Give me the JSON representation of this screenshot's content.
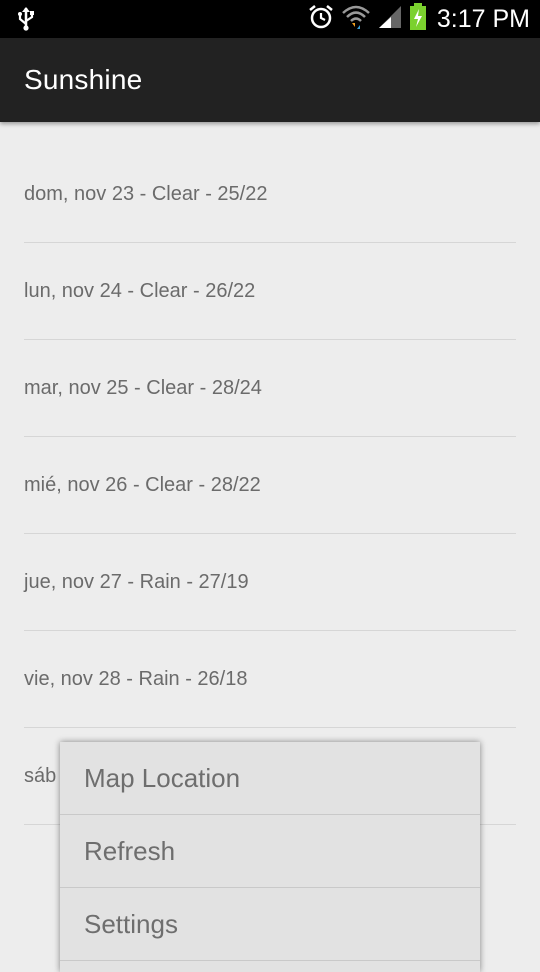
{
  "status_bar": {
    "time": "3:17 PM",
    "icons": [
      "usb-icon",
      "alarm-icon",
      "wifi-icon",
      "signal-icon",
      "battery-charging-icon"
    ]
  },
  "action_bar": {
    "title": "Sunshine"
  },
  "forecast": [
    "dom, nov 23 - Clear - 25/22",
    "lun, nov 24 - Clear - 26/22",
    "mar, nov 25 - Clear - 28/24",
    "mié, nov 26 - Clear - 28/22",
    "jue, nov 27 - Rain - 27/19",
    "vie, nov 28 - Rain - 26/18",
    "sáb"
  ],
  "overflow_menu": {
    "items": [
      "Map Location",
      "Refresh",
      "Settings"
    ]
  },
  "colors": {
    "status_bar": "#000000",
    "action_bar": "#222222",
    "background": "#ededed",
    "menu": "#e2e2e2",
    "battery": "#7bd12e"
  }
}
